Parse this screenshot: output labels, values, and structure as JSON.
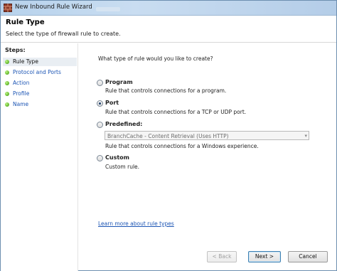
{
  "window": {
    "title": "New Inbound Rule Wizard"
  },
  "header": {
    "title": "Rule Type",
    "subtitle": "Select the type of firewall rule to create."
  },
  "steps": {
    "title": "Steps:",
    "items": [
      {
        "label": "Rule Type",
        "state": "current"
      },
      {
        "label": "Protocol and Ports",
        "state": "link"
      },
      {
        "label": "Action",
        "state": "link"
      },
      {
        "label": "Profile",
        "state": "link"
      },
      {
        "label": "Name",
        "state": "link"
      }
    ]
  },
  "content": {
    "question": "What type of rule would you like to create?",
    "options": [
      {
        "title": "Program",
        "description": "Rule that controls connections for a program.",
        "selected": false
      },
      {
        "title": "Port",
        "description": "Rule that controls connections for a TCP or UDP port.",
        "selected": true
      },
      {
        "title": "Predefined:",
        "description": "Rule that controls connections for a Windows experience.",
        "selected": false
      },
      {
        "title": "Custom",
        "description": "Custom rule.",
        "selected": false
      }
    ],
    "predefined_select_value": "BranchCache - Content Retrieval (Uses HTTP)",
    "learn_more": "Learn more about rule types"
  },
  "buttons": {
    "back": "< Back",
    "next": "Next >",
    "cancel": "Cancel"
  },
  "colors": {
    "link": "#1c55b4",
    "step_dot": "#6fc136",
    "titlebar": "#c9ddf1"
  }
}
